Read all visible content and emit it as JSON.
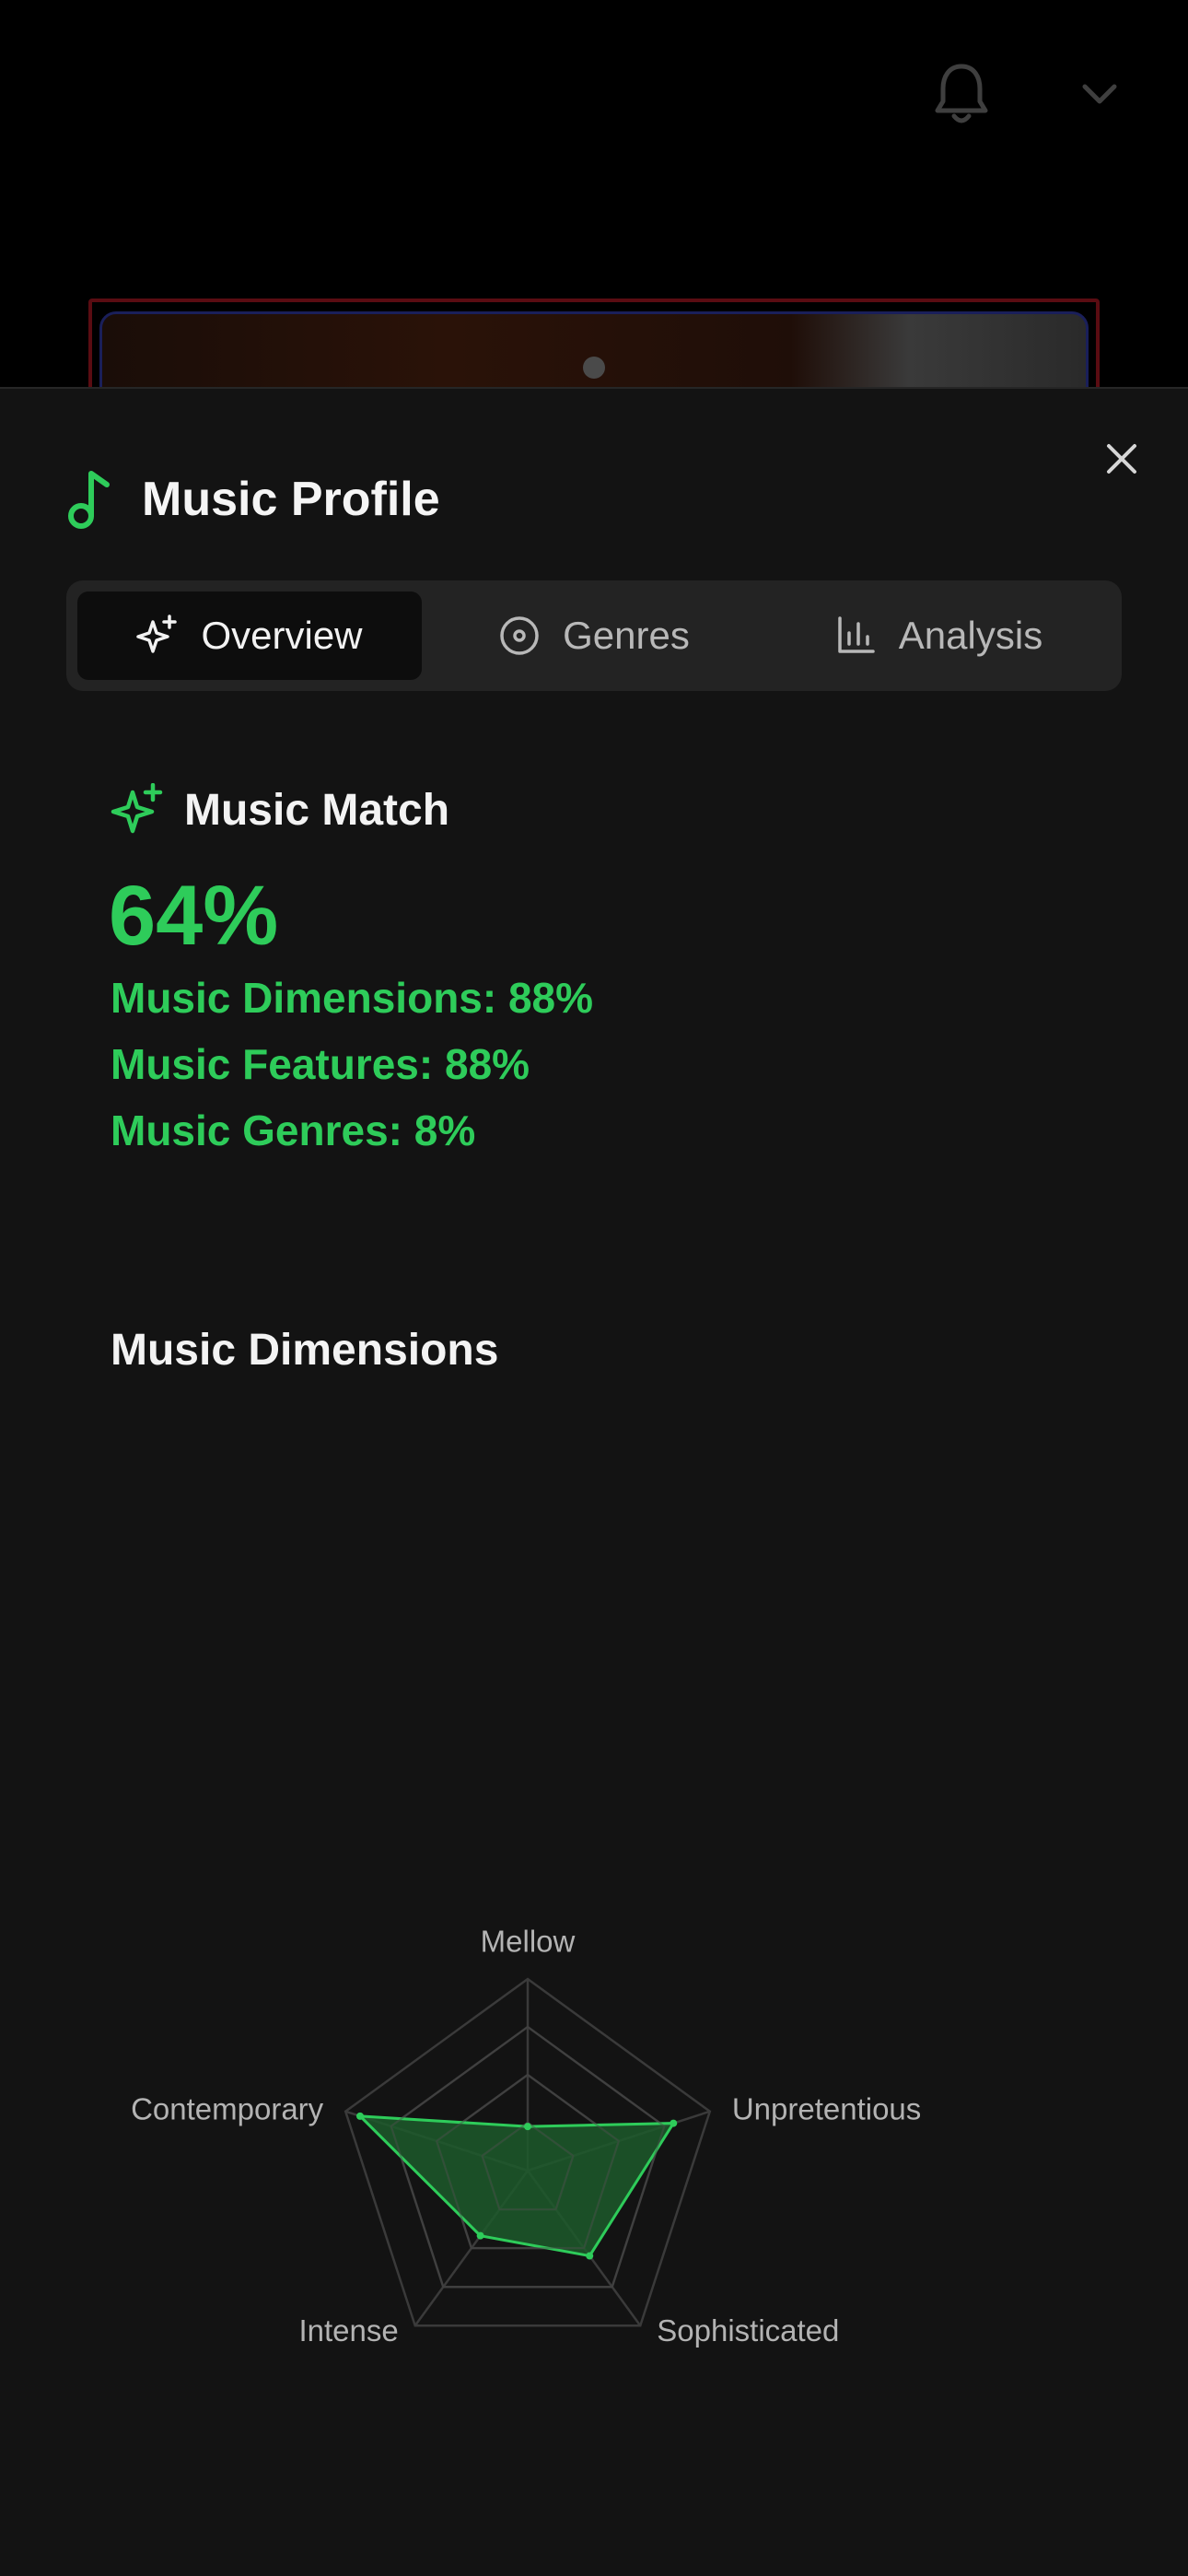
{
  "header": {
    "bell_icon": "bell-icon",
    "chevron_icon": "chevron-down-icon"
  },
  "sheet": {
    "title": "Music Profile",
    "title_icon": "music-note-icon",
    "close_icon": "close-icon",
    "accent_color": "#2ecc5a"
  },
  "tabs": [
    {
      "label": "Overview",
      "icon": "sparkles-icon",
      "active": true
    },
    {
      "label": "Genres",
      "icon": "disc-icon",
      "active": false
    },
    {
      "label": "Analysis",
      "icon": "bar-chart-icon",
      "active": false
    }
  ],
  "match": {
    "heading": "Music Match",
    "overall": "64%",
    "lines": [
      "Music Dimensions: 88%",
      "Music Features: 88%",
      "Music Genres: 8%"
    ]
  },
  "dimensions": {
    "title": "Music Dimensions"
  },
  "chart_data": {
    "type": "radar",
    "axes": [
      "Mellow",
      "Unpretentious",
      "Sophisticated",
      "Intense",
      "Contemporary"
    ],
    "values": [
      0.23,
      0.8,
      0.55,
      0.42,
      0.92
    ],
    "rings": 4,
    "fill_color": "#1d5a2c",
    "stroke_color": "#2ecc5a",
    "grid_color": "#3a3a3a"
  }
}
